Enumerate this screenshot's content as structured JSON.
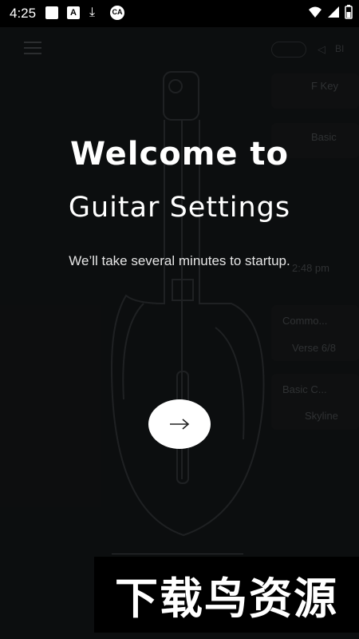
{
  "status_bar": {
    "time": "4:25",
    "icons": [
      "notification-square-icon",
      "a-badge-icon",
      "download-icon",
      "ca-app-icon",
      "wifi-icon",
      "cell-signal-icon",
      "battery-icon"
    ]
  },
  "app": {
    "menu_icon": "hamburger-menu-icon",
    "status": {
      "sound_icon": "speaker-icon",
      "bpm_label": "BI"
    },
    "right_panel": {
      "key_label": "F Key",
      "tone_label": "Basic",
      "time_label": "2:48 pm",
      "progression_title": "Commo...",
      "progression_value": "Verse 6/8",
      "preset_title": "Basic C...",
      "preset_value": "Skyline"
    }
  },
  "onboarding": {
    "title_line1": "Welcome to",
    "title_line2": "Guitar Settings",
    "subtitle": "We’ll take several minutes to startup.",
    "next_icon": "arrow-right-icon"
  },
  "watermark": {
    "text": "下载鸟资源"
  },
  "colors": {
    "background": "#111314",
    "button": "#ffffff",
    "text": "#ffffff"
  }
}
